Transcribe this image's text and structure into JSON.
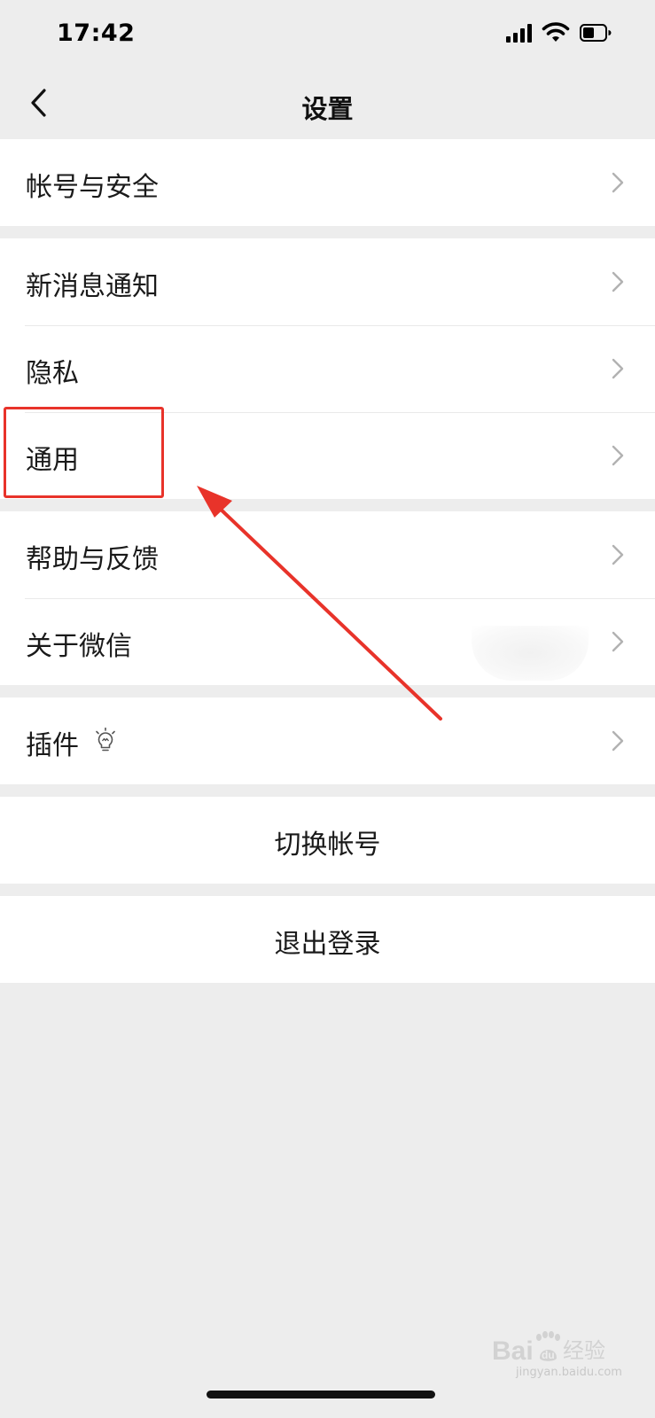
{
  "status_bar": {
    "time": "17:42",
    "icons": [
      "signal-icon",
      "wifi-icon",
      "battery-icon"
    ]
  },
  "nav": {
    "title": "设置",
    "back_icon": "chevron-left-icon"
  },
  "groups": [
    {
      "items": [
        {
          "label": "帐号与安全"
        }
      ]
    },
    {
      "items": [
        {
          "label": "新消息通知"
        },
        {
          "label": "隐私"
        },
        {
          "label": "通用"
        }
      ]
    },
    {
      "items": [
        {
          "label": "帮助与反馈"
        },
        {
          "label": "关于微信"
        }
      ]
    },
    {
      "items": [
        {
          "label": "插件",
          "icon": "lightbulb-icon"
        }
      ]
    }
  ],
  "actions": {
    "switch_account": "切换帐号",
    "logout": "退出登录"
  },
  "annotation": {
    "highlighted_item": "通用",
    "color": "#e8332a"
  },
  "watermark": {
    "brand": "Baidu经验",
    "domain": "jingyan.baidu.com"
  },
  "colors": {
    "background": "#ededed",
    "cell_background": "#ffffff",
    "separator": "#e9e9e9",
    "chevron": "#b2b2b2"
  }
}
